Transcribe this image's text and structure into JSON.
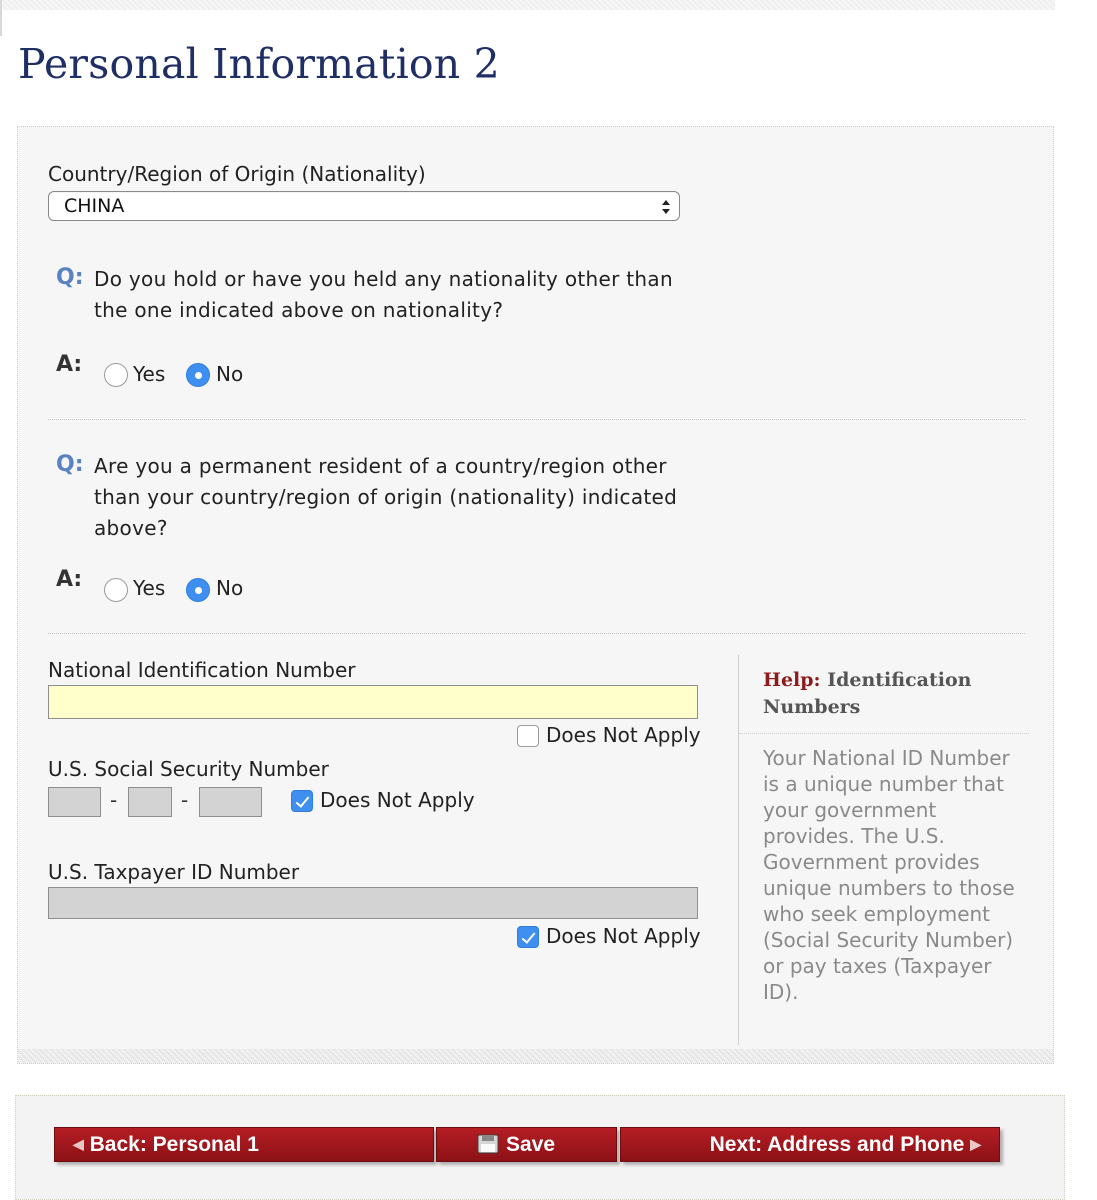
{
  "page": {
    "title": "Personal Information 2"
  },
  "nationality": {
    "label": "Country/Region of Origin (Nationality)",
    "selected": "CHINA"
  },
  "markers": {
    "q": "Q:",
    "a": "A:"
  },
  "question_other_nationality": {
    "text": "Do you hold or have you held any nationality other than the one indicated above on nationality?",
    "options": [
      "Yes",
      "No"
    ],
    "selected": "No"
  },
  "question_permanent_resident": {
    "text": "Are you a permanent resident of a country/region other than your country/region of origin (nationality) indicated above?",
    "options": [
      "Yes",
      "No"
    ],
    "selected": "No"
  },
  "national_id": {
    "label": "National Identification Number",
    "value": "",
    "does_not_apply_label": "Does Not Apply",
    "does_not_apply": false
  },
  "ssn": {
    "label": "U.S. Social Security Number",
    "parts": [
      "",
      "",
      ""
    ],
    "separator": "-",
    "does_not_apply_label": "Does Not Apply",
    "does_not_apply": true
  },
  "taxpayer_id": {
    "label": "U.S. Taxpayer ID Number",
    "value": "",
    "does_not_apply_label": "Does Not Apply",
    "does_not_apply": true
  },
  "help": {
    "key": "Help:",
    "topic": "Identification Numbers",
    "text": "Your National ID Number is a unique number that your government provides. The U.S. Government provides unique numbers to those who seek employment (Social Security Number) or pay taxes (Taxpayer ID)."
  },
  "nav": {
    "back_label": "Back: Personal 1",
    "save_label": "Save",
    "next_label": "Next: Address and Phone"
  },
  "colors": {
    "title": "#1f2f66",
    "nav_button": "#a3181e",
    "id_input_bg": "#ffffcc",
    "disabled_input_bg": "#d3d3d3",
    "control_blue": "#3f8ff0"
  }
}
